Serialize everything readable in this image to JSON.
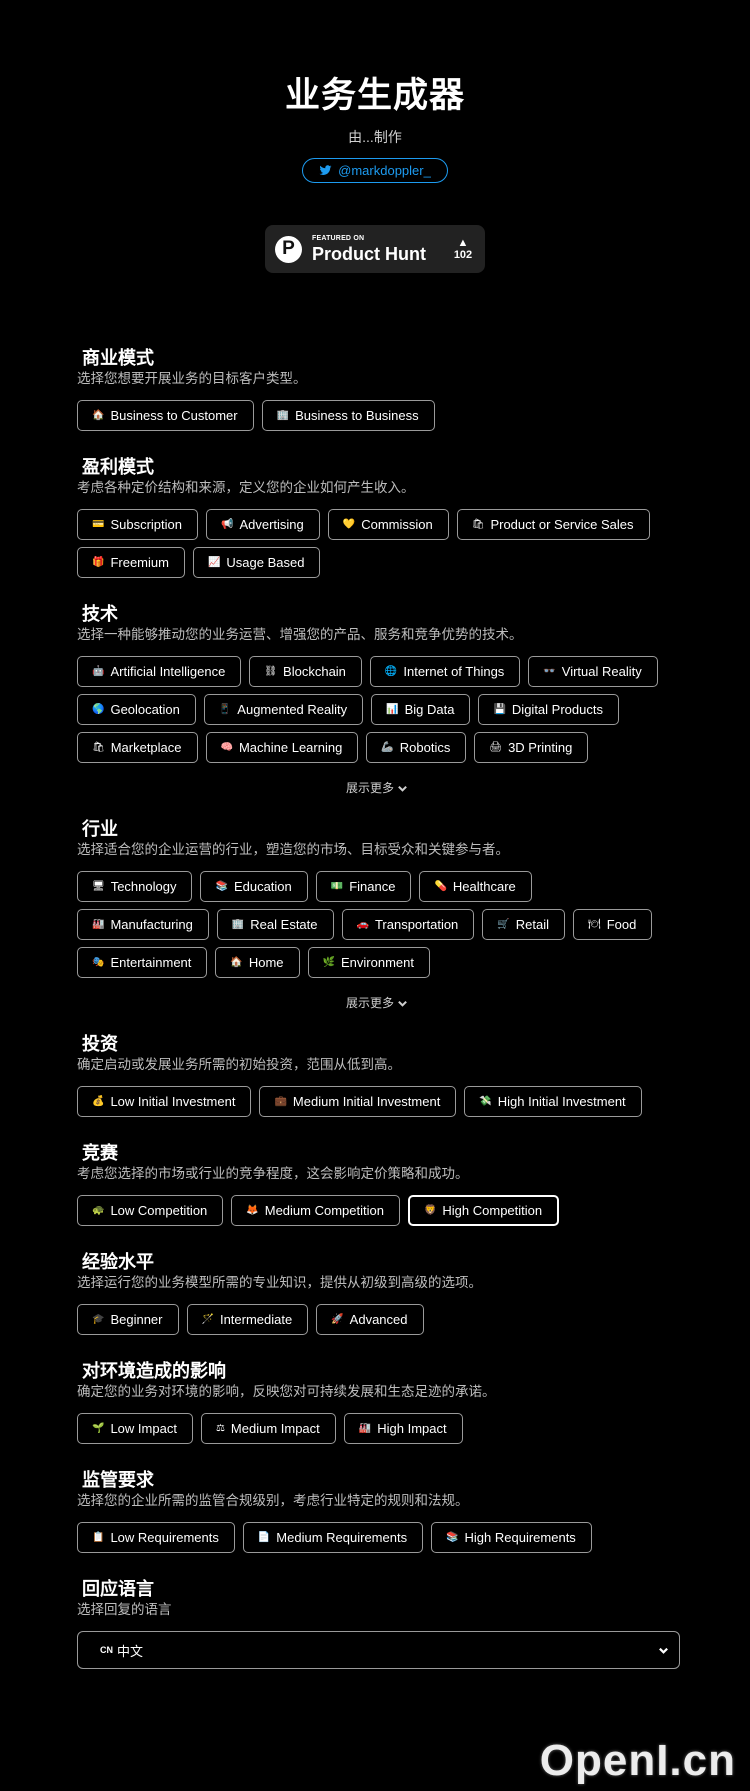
{
  "header": {
    "title": "业务生成器",
    "made_by": "由...制作",
    "twitter_handle": "@markdoppler_"
  },
  "product_hunt": {
    "featured_on": "FEATURED ON",
    "name": "Product Hunt",
    "logo_letter": "P",
    "arrow": "▲",
    "count": "102"
  },
  "sections": {
    "business_model": {
      "title": "商业模式",
      "desc": "选择您想要开展业务的目标客户类型。",
      "options": [
        {
          "icon": "🏠",
          "label": "Business to Customer"
        },
        {
          "icon": "🏢",
          "label": "Business to Business"
        }
      ]
    },
    "revenue_model": {
      "title": "盈利模式",
      "desc": "考虑各种定价结构和来源，定义您的企业如何产生收入。",
      "options": [
        {
          "icon": "💳",
          "label": "Subscription"
        },
        {
          "icon": "📢",
          "label": "Advertising"
        },
        {
          "icon": "💛",
          "label": "Commission"
        },
        {
          "icon": "🛍",
          "label": "Product or Service Sales"
        },
        {
          "icon": "🎁",
          "label": "Freemium"
        },
        {
          "icon": "📈",
          "label": "Usage Based"
        }
      ]
    },
    "technology": {
      "title": "技术",
      "desc": "选择一种能够推动您的业务运营、增强您的产品、服务和竞争优势的技术。",
      "options": [
        {
          "icon": "🤖",
          "label": "Artificial Intelligence"
        },
        {
          "icon": "⛓",
          "label": "Blockchain"
        },
        {
          "icon": "🌐",
          "label": "Internet of Things"
        },
        {
          "icon": "👓",
          "label": "Virtual Reality"
        },
        {
          "icon": "🌎",
          "label": "Geolocation"
        },
        {
          "icon": "📱",
          "label": "Augmented Reality"
        },
        {
          "icon": "📊",
          "label": "Big Data"
        },
        {
          "icon": "💾",
          "label": "Digital Products"
        },
        {
          "icon": "🛍",
          "label": "Marketplace"
        },
        {
          "icon": "🧠",
          "label": "Machine Learning"
        },
        {
          "icon": "🦾",
          "label": "Robotics"
        },
        {
          "icon": "🖨",
          "label": "3D Printing"
        }
      ],
      "show_more": "展示更多"
    },
    "industry": {
      "title": "行业",
      "desc": "选择适合您的企业运营的行业，塑造您的市场、目标受众和关键参与者。",
      "options": [
        {
          "icon": "🖥",
          "label": "Technology"
        },
        {
          "icon": "📚",
          "label": "Education"
        },
        {
          "icon": "💵",
          "label": "Finance"
        },
        {
          "icon": "💊",
          "label": "Healthcare"
        },
        {
          "icon": "🏭",
          "label": "Manufacturing"
        },
        {
          "icon": "🏢",
          "label": "Real Estate"
        },
        {
          "icon": "🚗",
          "label": "Transportation"
        },
        {
          "icon": "🛒",
          "label": "Retail"
        },
        {
          "icon": "🍽",
          "label": "Food"
        },
        {
          "icon": "🎭",
          "label": "Entertainment"
        },
        {
          "icon": "🏠",
          "label": "Home"
        },
        {
          "icon": "🌿",
          "label": "Environment"
        }
      ],
      "show_more": "展示更多"
    },
    "investment": {
      "title": "投资",
      "desc": "确定启动或发展业务所需的初始投资，范围从低到高。",
      "options": [
        {
          "icon": "💰",
          "label": "Low Initial Investment"
        },
        {
          "icon": "💼",
          "label": "Medium Initial Investment"
        },
        {
          "icon": "💸",
          "label": "High Initial Investment"
        }
      ]
    },
    "competition": {
      "title": "竞赛",
      "desc": "考虑您选择的市场或行业的竞争程度，这会影响定价策略和成功。",
      "options": [
        {
          "icon": "🐢",
          "label": "Low Competition"
        },
        {
          "icon": "🦊",
          "label": "Medium Competition"
        },
        {
          "icon": "🦁",
          "label": "High Competition"
        }
      ],
      "selected": "High Competition"
    },
    "experience": {
      "title": "经验水平",
      "desc": "选择运行您的业务模型所需的专业知识，提供从初级到高级的选项。",
      "options": [
        {
          "icon": "🎓",
          "label": "Beginner"
        },
        {
          "icon": "🪄",
          "label": "Intermediate"
        },
        {
          "icon": "🚀",
          "label": "Advanced"
        }
      ]
    },
    "environment": {
      "title": "对环境造成的影响",
      "desc": "确定您的业务对环境的影响，反映您对可持续发展和生态足迹的承诺。",
      "options": [
        {
          "icon": "🌱",
          "label": "Low Impact"
        },
        {
          "icon": "⚖",
          "label": "Medium Impact"
        },
        {
          "icon": "🏭",
          "label": "High Impact"
        }
      ]
    },
    "regulation": {
      "title": "监管要求",
      "desc": "选择您的企业所需的监管合规级别，考虑行业特定的规则和法规。",
      "options": [
        {
          "icon": "📋",
          "label": "Low Requirements"
        },
        {
          "icon": "📄",
          "label": "Medium Requirements"
        },
        {
          "icon": "📚",
          "label": "High Requirements"
        }
      ]
    },
    "language": {
      "title": "回应语言",
      "desc": "选择回复的语言",
      "flag": "CN",
      "selected": "中文"
    }
  },
  "watermark": "OpenI.cn",
  "colors": {
    "background": "#000000",
    "twitter": "#1d9bf0",
    "chip_border": "#9a9a9a",
    "selected_border": "#ffffff",
    "ph_badge": "#222222"
  }
}
